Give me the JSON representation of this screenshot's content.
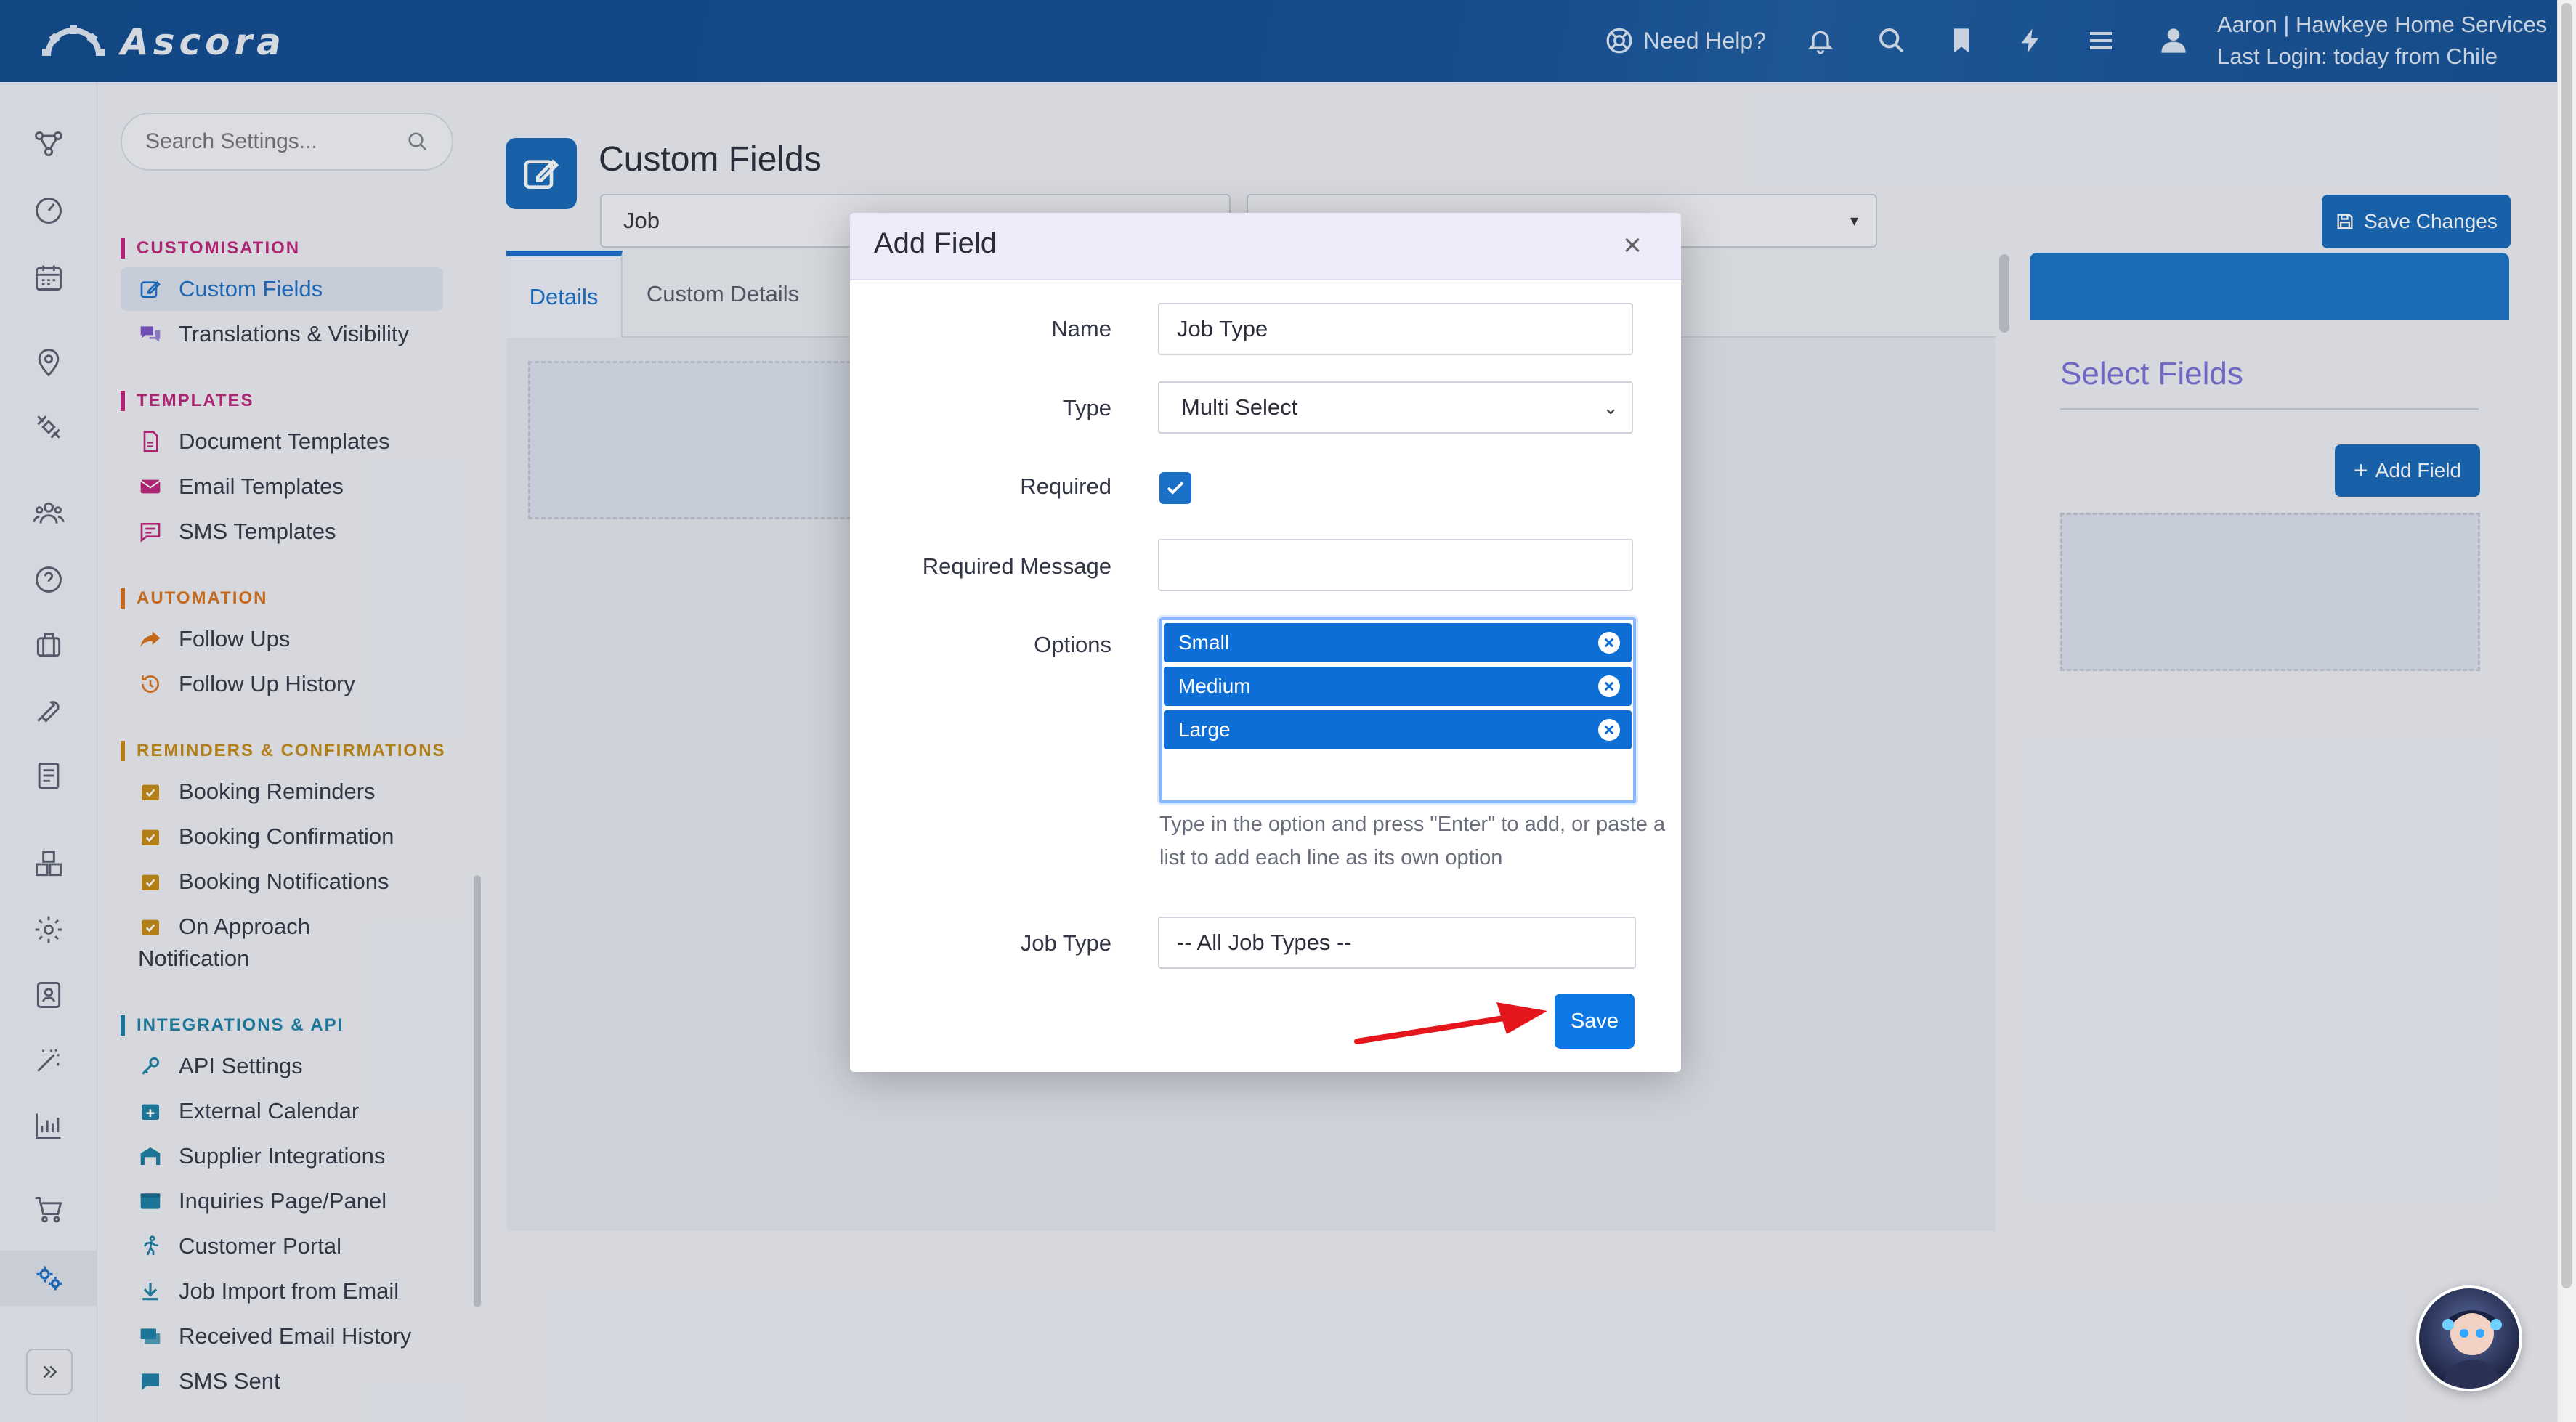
{
  "header": {
    "logo_text": "Ascora",
    "help_label": "Need Help?",
    "user_line1": "Aaron | Hawkeye Home Services",
    "user_line2": "Last Login: today from Chile"
  },
  "sidebar": {
    "search_placeholder": "Search Settings...",
    "sections": [
      {
        "title": "CUSTOMISATION",
        "color": "#c0247a",
        "items": [
          "Custom Fields",
          "Translations & Visibility"
        ]
      },
      {
        "title": "TEMPLATES",
        "color": "#c0247a",
        "items": [
          "Document Templates",
          "Email Templates",
          "SMS Templates"
        ]
      },
      {
        "title": "AUTOMATION",
        "color": "#d9701a",
        "items": [
          "Follow Ups",
          "Follow Up History"
        ]
      },
      {
        "title": "REMINDERS & CONFIRMATIONS",
        "color": "#c58a12",
        "items": [
          "Booking Reminders",
          "Booking Confirmation",
          "Booking Notifications",
          "On Approach",
          "Notification"
        ]
      },
      {
        "title": "INTEGRATIONS & API",
        "color": "#1b7fa3",
        "items": [
          "API Settings",
          "External Calendar",
          "Supplier Integrations",
          "Inquiries Page/Panel",
          "Customer Portal",
          "Job Import from Email",
          "Received Email History",
          "SMS Sent"
        ]
      }
    ]
  },
  "page": {
    "title": "Custom Fields",
    "entity_select": "Job",
    "save_changes_label": "Save Changes",
    "tabs": [
      "Details",
      "Custom Details"
    ],
    "right_panel_title": "Select Fields",
    "add_field_label": "Add Field"
  },
  "modal": {
    "title": "Add Field",
    "close_glyph": "×",
    "name_label": "Name",
    "name_value": "Job Type",
    "type_label": "Type",
    "type_value": "Multi Select",
    "required_label": "Required",
    "required_checked": true,
    "required_message_label": "Required Message",
    "required_message_value": "",
    "options_label": "Options",
    "options": [
      "Small",
      "Medium",
      "Large"
    ],
    "options_help": "Type in the option and press \"Enter\" to add, or paste a list to add each line as its own option",
    "job_type_label": "Job Type",
    "job_type_value": "-- All Job Types --",
    "save_label": "Save"
  },
  "colors": {
    "header_bg": "#134f95",
    "primary": "#1668b8",
    "accent_purple": "#7d6fd8",
    "annotation_arrow": "#e4161b"
  }
}
